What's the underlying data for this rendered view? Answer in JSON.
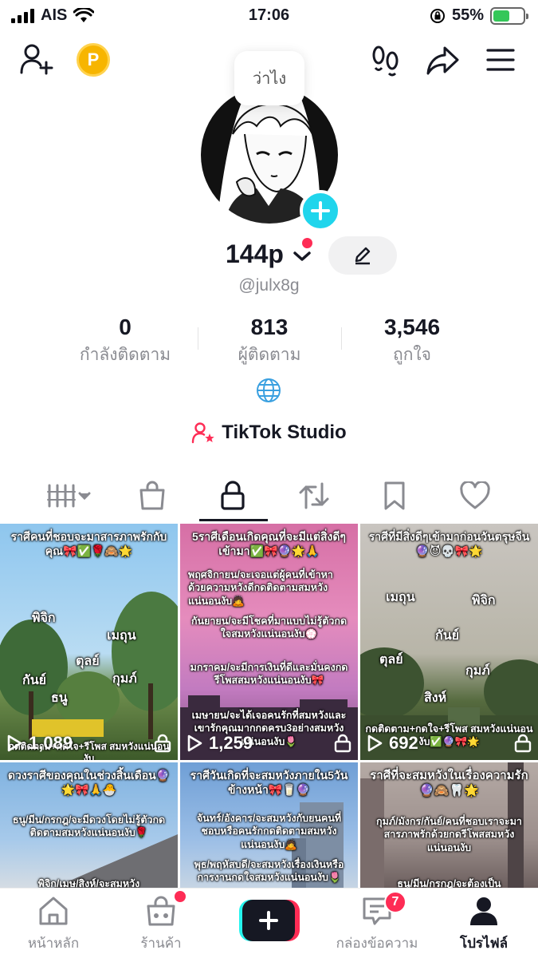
{
  "status_bar": {
    "carrier": "AIS",
    "time": "17:06",
    "battery": "55%"
  },
  "profile": {
    "bubble_text": "ว่าไง",
    "username": "144p",
    "handle": "@julx8g",
    "stats": [
      {
        "value": "0",
        "label": "กำลังติดตาม"
      },
      {
        "value": "813",
        "label": "ผู้ติดตาม"
      },
      {
        "value": "3,546",
        "label": "ถูกใจ"
      }
    ],
    "studio_label": "TikTok Studio"
  },
  "videos": [
    {
      "caption": "ราศีคนที่ชอบจะมาสารภาพรักกับคุณ🎀✅🌹🙈🌟",
      "words": [
        "พิจิก",
        "เมถุน",
        "ตุลย์",
        "กันย์",
        "กุมภ์",
        "ธนู"
      ],
      "views": "1,089",
      "overlay": "กดติดตาม+กดใจ+รีโพส สมหวังแน่นอนงับ"
    },
    {
      "caption": "5ราศีเดือนเกิดคุณที่จะมีแต่สิ่งดีๆเข้ามา✅🎀🔮🌟🙏",
      "body": [
        "พฤศจิกายน/จะเจอแต่ผู้คนที่เข้าหาด้วยความหวังดีกดติดตามสมหวังแน่นอนงับ🙇",
        "กันยายน/จะมีโชคที่มาแบบไม่รู้ตัวกดใจสมหวังแน่นอนงับ💮",
        "มกราคม/จะมีการเงินที่ดีและมั่นคงกดรีโพสสมหวังแน่นอนงับ🎀",
        "เมษายน/จะได้เจอคนรักที่สมหวังและเขารักคุณมากกดครบ3อย่างสมหวังแน่นอนงับ🌷"
      ],
      "views": "1,259"
    },
    {
      "caption": "ราศีที่มีสิ่งดีๆเข้ามาก่อนวันตรุษจีน🔮😈💀🎀🌟",
      "words": [
        "เมถุน",
        "พิจิก",
        "กันย์",
        "ตุลย์",
        "กุมภ์",
        "สิงห์"
      ],
      "views": "692",
      "overlay": "กดติดตาม+กดใจ+รีโพส สมหวังแน่นอนงับ✅🔮🎀🌟"
    },
    {
      "caption": "ดวงราศีของคุณในช่วงสิ้นเดือน🔮🌟🎀🙏🐣",
      "body": [
        "ธนู/มีน/กรกฎ/จะมีดวงโดยไม่รู้ตัวกดติดตามสมหวังแน่นอนงับ🌹",
        "พิจิก/เมษ/สิงห์/จะสมหวัง"
      ]
    },
    {
      "caption": "ราศีวันเกิดที่จะสมหวังภายใน5วันข้างหน้า🎀🥛🔮",
      "body": [
        "จันทร์/อังคาร/จะสมหวังกับยนคนที่ชอบหรือคนรักกดติดตามสมหวังแน่นอนงับ🙇",
        "พุธ/พฤหัสบดี/จะสมหวังเรื่องเงินหรือการงานกดใจสมหวังแน่นอนงับ🌷"
      ]
    },
    {
      "caption": "ราศีที่จะสมหวังในเรื่องความรัก🔮🙈🦷🌟",
      "body": [
        "กุมภ์/มังกร/กันย์/คนที่ชอบเราจะมาสารภาพรักด้วยกดรีโพสสมหวังแน่นอนงับ",
        "ธนู/มีน/กรกฎ/จะต้องเป็น"
      ]
    }
  ],
  "bottom_nav": {
    "home": "หน้าหลัก",
    "shop": "ร้านค้า",
    "inbox": "กล่องข้อความ",
    "inbox_badge": "7",
    "profile": "โปรไฟล์"
  },
  "colors": {
    "accent": "#fe2c55",
    "cyan": "#25f4ee",
    "text": "#161823",
    "muted": "#8a8b91"
  }
}
